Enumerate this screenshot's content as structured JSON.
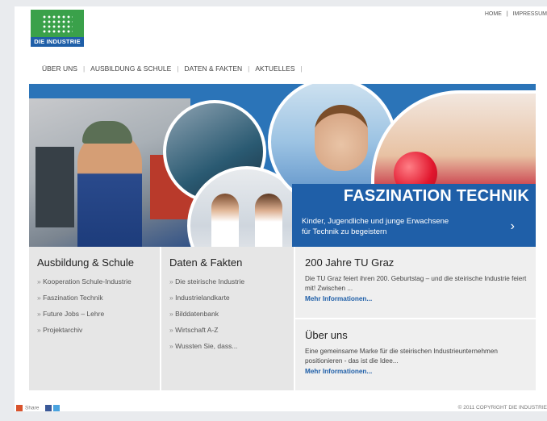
{
  "logo": {
    "text": "DIE INDUSTRIE"
  },
  "top_links": [
    "HOME",
    "IMPRESSUM"
  ],
  "nav": [
    "ÜBER UNS",
    "AUSBILDUNG & SCHULE",
    "DATEN & FAKTEN",
    "AKTUELLES"
  ],
  "hero": {
    "title": "FASZINATION TECHNIK",
    "subtitle_line1": "Kinder, Jugendliche und junge Erwachsene",
    "subtitle_line2": "für Technik zu begeistern",
    "arrow": "›"
  },
  "col1": {
    "heading": "Ausbildung & Schule",
    "items": [
      "Kooperation Schule-Industrie",
      "Faszination Technik",
      "Future Jobs – Lehre",
      "Projektarchiv"
    ]
  },
  "col2": {
    "heading": "Daten & Fakten",
    "items": [
      "Die steirische Industrie",
      "Industrielandkarte",
      "Bilddatenbank",
      "Wirtschaft A-Z",
      "Wussten Sie, dass..."
    ]
  },
  "news": [
    {
      "heading": "200 Jahre TU Graz",
      "text": "Die TU Graz feiert ihren 200. Geburtstag – und die steirische Industrie feiert mit! Zwischen ...",
      "link": "Mehr Informationen..."
    },
    {
      "heading": "Über uns",
      "text": "Eine gemeinsame Marke für die steirischen Industrieunternehmen positionieren - das ist die Idee...",
      "link": "Mehr Informationen..."
    }
  ],
  "footer": {
    "share": "Share",
    "copyright": "© 2011 COPYRIGHT DIE INDUSTRIE"
  }
}
